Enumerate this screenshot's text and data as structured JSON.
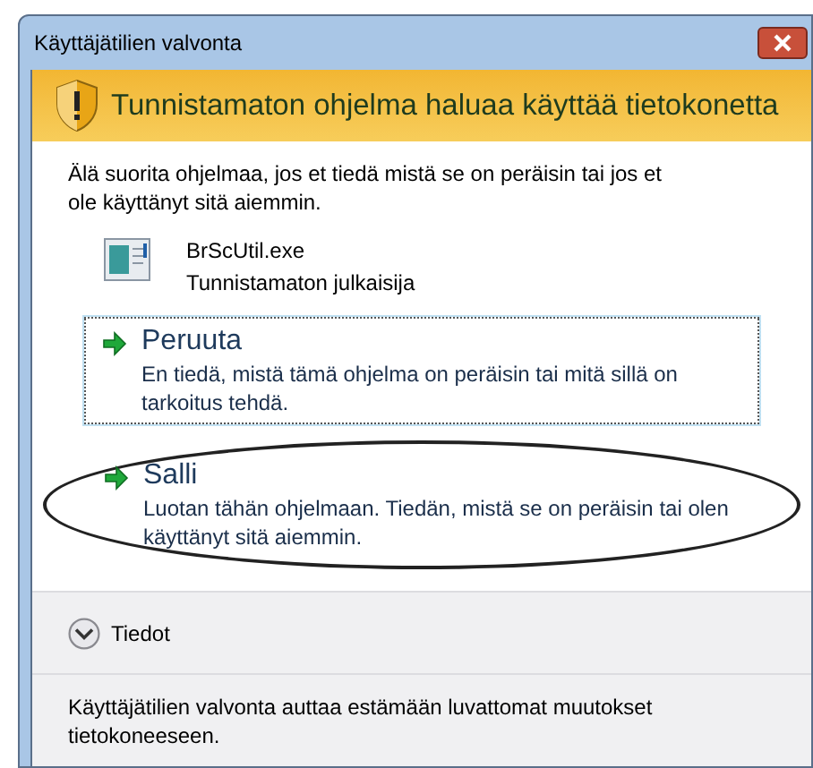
{
  "window": {
    "title": "Käyttäjätilien valvonta"
  },
  "banner": {
    "text": "Tunnistamaton ohjelma haluaa käyttää tietokonetta"
  },
  "warning": "Älä suorita ohjelmaa, jos et tiedä mistä se on peräisin tai jos et ole käyttänyt sitä aiemmin.",
  "program": {
    "name": "BrScUtil.exe",
    "publisher": "Tunnistamaton julkaisija"
  },
  "options": [
    {
      "title": "Peruuta",
      "description": "En tiedä, mistä tämä ohjelma on peräisin tai mitä sillä on tarkoitus tehdä.",
      "focused": true,
      "circled": false
    },
    {
      "title": "Salli",
      "description": "Luotan tähän ohjelmaan. Tiedän, mistä se on peräisin tai olen käyttänyt sitä aiemmin.",
      "focused": false,
      "circled": true
    }
  ],
  "details": {
    "label": "Tiedot",
    "expanded": false
  },
  "footer": "Käyttäjätilien valvonta auttaa estämään luvattomat muutokset tietokoneeseen."
}
